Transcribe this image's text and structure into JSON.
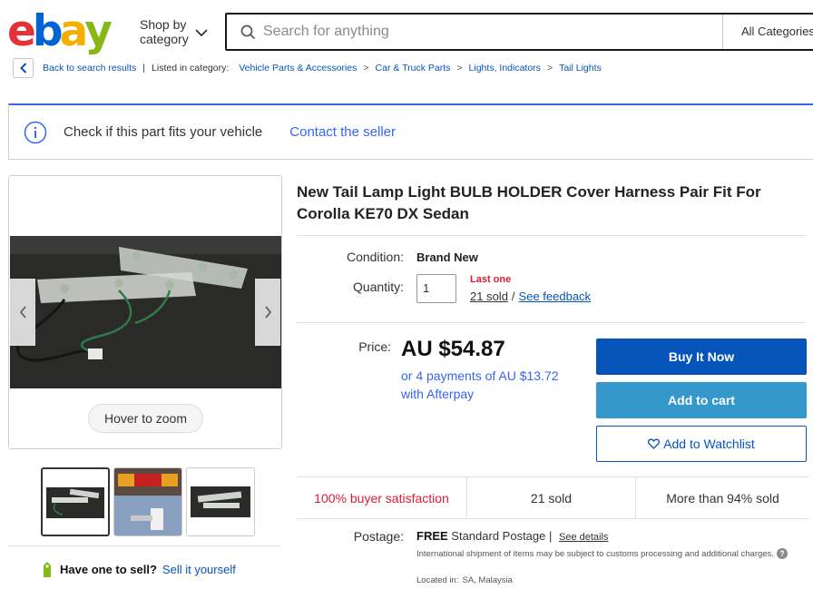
{
  "header": {
    "logo_letters": [
      {
        "char": "e",
        "color": "#e53238"
      },
      {
        "char": "b",
        "color": "#0064d2"
      },
      {
        "char": "a",
        "color": "#f5af02"
      },
      {
        "char": "y",
        "color": "#86b817"
      }
    ],
    "shop_by_label": "Shop by category",
    "search_placeholder": "Search for anything",
    "category_select": "All Categories"
  },
  "breadcrumb": {
    "back_label": "Back to search results",
    "listed_label": "Listed in category:",
    "items": [
      "Vehicle Parts & Accessories",
      "Car & Truck Parts",
      "Lights, Indicators",
      "Tail Lights"
    ]
  },
  "fitment": {
    "check_label": "Check if this part fits your vehicle",
    "contact_label": "Contact the seller"
  },
  "gallery": {
    "zoom_label": "Hover to zoom",
    "thumbnail_count": 3
  },
  "sell": {
    "have_label": "Have one to sell?",
    "sell_label": "Sell it yourself"
  },
  "item": {
    "title": "New Tail Lamp Light BULB HOLDER Cover Harness Pair Fit For Corolla KE70 DX Sedan",
    "condition_label": "Condition:",
    "condition_value": "Brand New",
    "quantity_label": "Quantity:",
    "quantity_value": "1",
    "last_one": "Last one",
    "sold_link": "21 sold",
    "feedback_link": "See feedback",
    "price_label": "Price:",
    "price": "AU $54.87",
    "afterpay": "or 4 payments of AU $13.72 with Afterpay"
  },
  "buttons": {
    "buy_now": "Buy It Now",
    "add_to_cart": "Add to cart",
    "watchlist": "Add to Watchlist"
  },
  "stats": {
    "satisfaction": "100% buyer satisfaction",
    "sold": "21 sold",
    "sold_percent": "More than 94% sold"
  },
  "postage": {
    "label": "Postage:",
    "free": "FREE",
    "service": "Standard Postage |",
    "details_link": "See details",
    "international_note": "International shipment of items may be subject to customs processing and additional charges.",
    "located_label": "Located in:",
    "located_value": "SA, Malaysia"
  },
  "colors": {
    "link": "#0654ba",
    "accent_blue": "#3665f3",
    "buy_button": "#0654ba",
    "cart_button": "#3498ca",
    "alert_red": "#dd1e31"
  }
}
